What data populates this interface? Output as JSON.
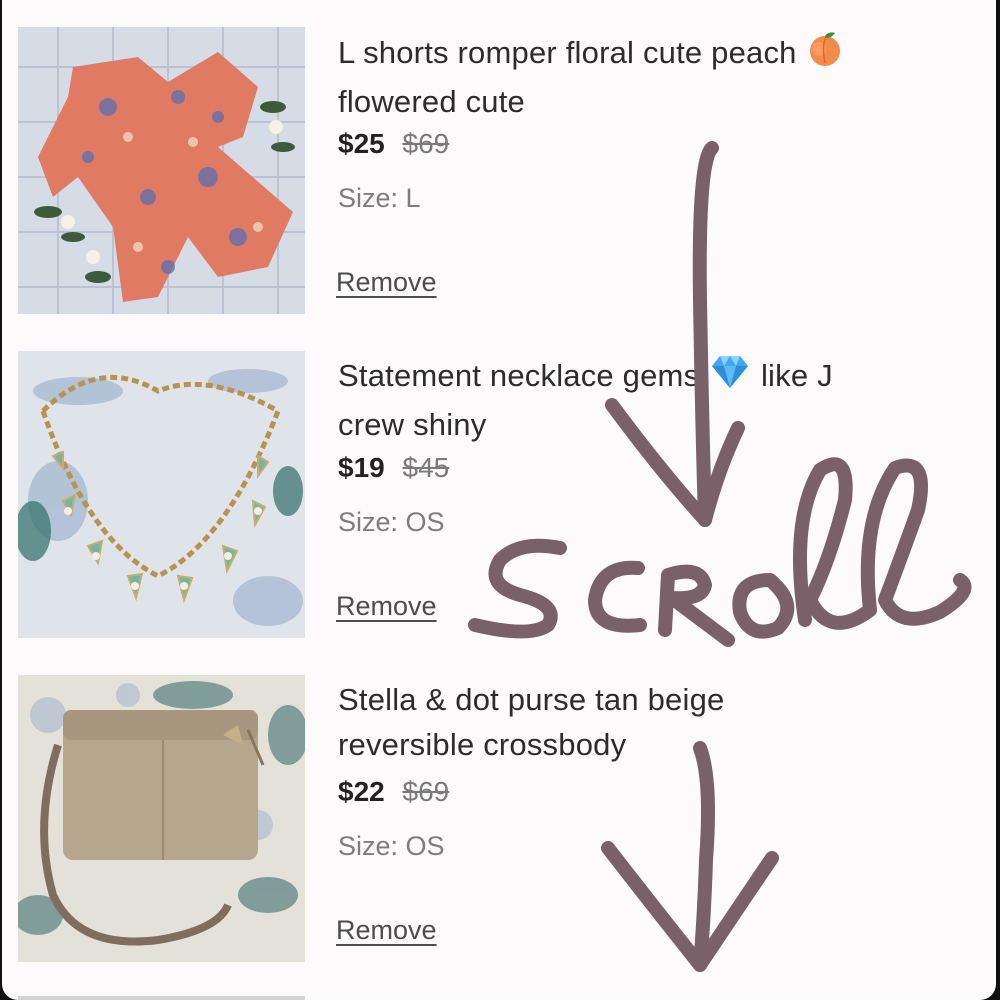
{
  "cart": {
    "items": [
      {
        "title": "L shorts romper floral cute peach",
        "title_emoji": "peach-emoji",
        "title_line2": "flowered cute",
        "price": "$25",
        "original_price": "$69",
        "size": "Size: L",
        "remove_label": "Remove",
        "image": "floral-romper-photo"
      },
      {
        "title_part1": "Statement necklace gems",
        "title_emoji": "gem-emoji",
        "title_part2": "like J",
        "title_line2": "crew shiny",
        "price": "$19",
        "original_price": "$45",
        "size": "Size: OS",
        "remove_label": "Remove",
        "image": "necklace-photo"
      },
      {
        "title": "Stella & dot purse tan beige",
        "title_line2": "reversible crossbody",
        "price": "$22",
        "original_price": "$69",
        "size": "Size: OS",
        "remove_label": "Remove",
        "image": "tan-purse-photo"
      }
    ]
  },
  "annotation": {
    "handwritten_text": "Scroll",
    "arrows": "down-arrow-icons",
    "color": "#7a6068"
  },
  "colors": {
    "background": "#fcfafb",
    "text": "#2c2c2c",
    "muted": "#7d7d7d"
  }
}
